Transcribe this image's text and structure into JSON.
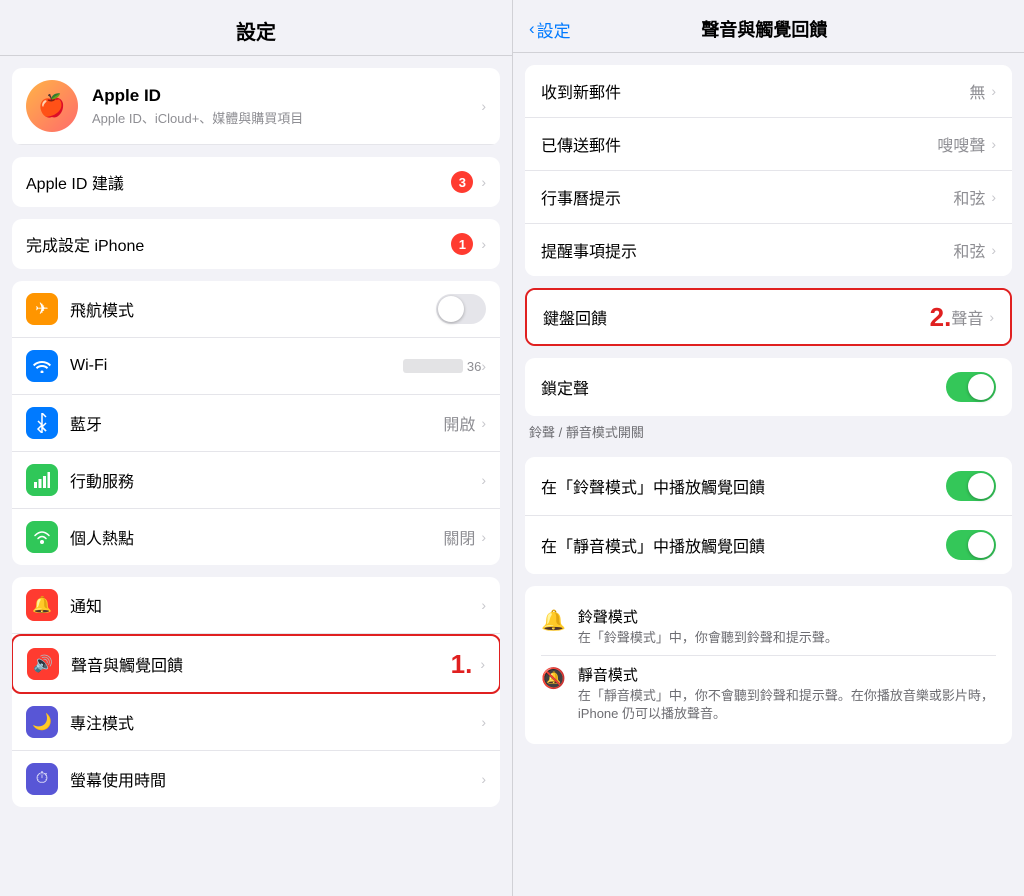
{
  "left": {
    "header": "設定",
    "apple_id_row": {
      "subtitle": "Apple ID、iCloud+、媒體與購買項目"
    },
    "apple_id_suggestion": {
      "label": "Apple ID 建議",
      "badge": "3"
    },
    "complete_setup": {
      "label": "完成設定 iPhone",
      "badge": "1"
    },
    "network_group": [
      {
        "label": "飛航模式",
        "icon_color": "#ff9500",
        "icon": "✈",
        "value": "",
        "toggle": true,
        "toggle_on": false
      },
      {
        "label": "Wi-Fi",
        "icon_color": "#007aff",
        "icon": "wifi",
        "value": "blurred",
        "toggle": false
      },
      {
        "label": "藍牙",
        "icon_color": "#007aff",
        "icon": "bluetooth",
        "value": "開啟",
        "toggle": false
      },
      {
        "label": "行動服務",
        "icon_color": "#30c759",
        "icon": "cellular",
        "value": "",
        "toggle": false
      },
      {
        "label": "個人熱點",
        "icon_color": "#30c759",
        "icon": "hotspot",
        "value": "關閉",
        "toggle": false
      }
    ],
    "app_group": [
      {
        "label": "通知",
        "icon_color": "#ff3b30",
        "icon": "🔔"
      },
      {
        "label": "聲音與觸覺回饋",
        "icon_color": "#ff3b30",
        "icon": "🔊",
        "highlighted": true,
        "step": "1."
      },
      {
        "label": "專注模式",
        "icon_color": "#5856d6",
        "icon": "🌙"
      },
      {
        "label": "螢幕使用時間",
        "icon_color": "#5856d6",
        "icon": "⏱"
      }
    ]
  },
  "right": {
    "header": "聲音與觸覺回饋",
    "back_label": "設定",
    "mail_group": [
      {
        "label": "收到新郵件",
        "value": "無"
      },
      {
        "label": "已傳送郵件",
        "value": "嗖嗖聲"
      },
      {
        "label": "行事曆提示",
        "value": "和弦"
      },
      {
        "label": "提醒事項提示",
        "value": "和弦"
      }
    ],
    "keyboard_row": {
      "label": "鍵盤回饋",
      "value": "聲音",
      "highlighted": true,
      "step": "2."
    },
    "lock_row": {
      "label": "鎖定聲",
      "toggle_on": true
    },
    "haptic_section_label": "鈴聲 / 靜音模式開關",
    "haptic_group": [
      {
        "label": "在「鈴聲模式」中播放觸覺回饋",
        "toggle_on": true
      },
      {
        "label": "在「靜音模式」中播放觸覺回饋",
        "toggle_on": true
      }
    ],
    "info_group": [
      {
        "icon": "🔔",
        "title": "鈴聲模式",
        "sub": "在「鈴聲模式」中，你會聽到鈴聲和提示聲。"
      },
      {
        "icon": "🔕",
        "title": "靜音模式",
        "sub": "在「靜音模式」中，你不會聽到鈴聲和提示聲。在你播放音樂或影片時，iPhone 仍可以播放聲音。"
      }
    ]
  }
}
